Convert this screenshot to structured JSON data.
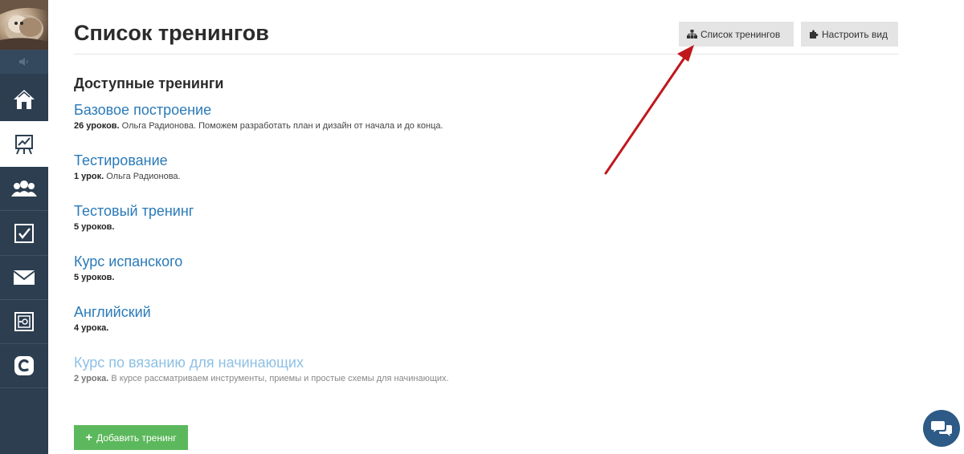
{
  "page": {
    "title": "Список тренингов"
  },
  "toolbar": {
    "list_button": "Список тренингов",
    "configure_button": "Настроить вид"
  },
  "section": {
    "title": "Доступные тренинги"
  },
  "trainings": [
    {
      "name": "Базовое построение",
      "lessons": "26 уроков.",
      "description": "Ольга Радионова. Поможем разработать план и дизайн от начала и до конца."
    },
    {
      "name": "Тестирование",
      "lessons": "1 урок.",
      "description": "Ольга Радионова."
    },
    {
      "name": "Тестовый тренинг",
      "lessons": "5 уроков.",
      "description": ""
    },
    {
      "name": "Курс испанского",
      "lessons": "5 уроков.",
      "description": ""
    },
    {
      "name": "Английский",
      "lessons": "4 урока.",
      "description": ""
    },
    {
      "name": "Курс по вязанию для начинающих",
      "lessons": "2 урока.",
      "description": "В курсе рассматриваем инструменты, приемы и простые схемы для начинающих."
    }
  ],
  "actions": {
    "add_training": "Добавить тренинг"
  },
  "sidebar": {
    "items": [
      {
        "icon": "home-icon"
      },
      {
        "icon": "training-chart-icon",
        "active": true
      },
      {
        "icon": "users-icon"
      },
      {
        "icon": "checkbox-icon"
      },
      {
        "icon": "mail-icon"
      },
      {
        "icon": "safe-icon"
      },
      {
        "icon": "c-logo-icon"
      }
    ]
  },
  "colors": {
    "sidebar_bg": "#2c3e50",
    "link": "#2a7ab8",
    "link_faded": "#8ec0e4",
    "add_button": "#5cb85c",
    "arrow": "#c0171c",
    "chat_button": "#2d5a86"
  }
}
